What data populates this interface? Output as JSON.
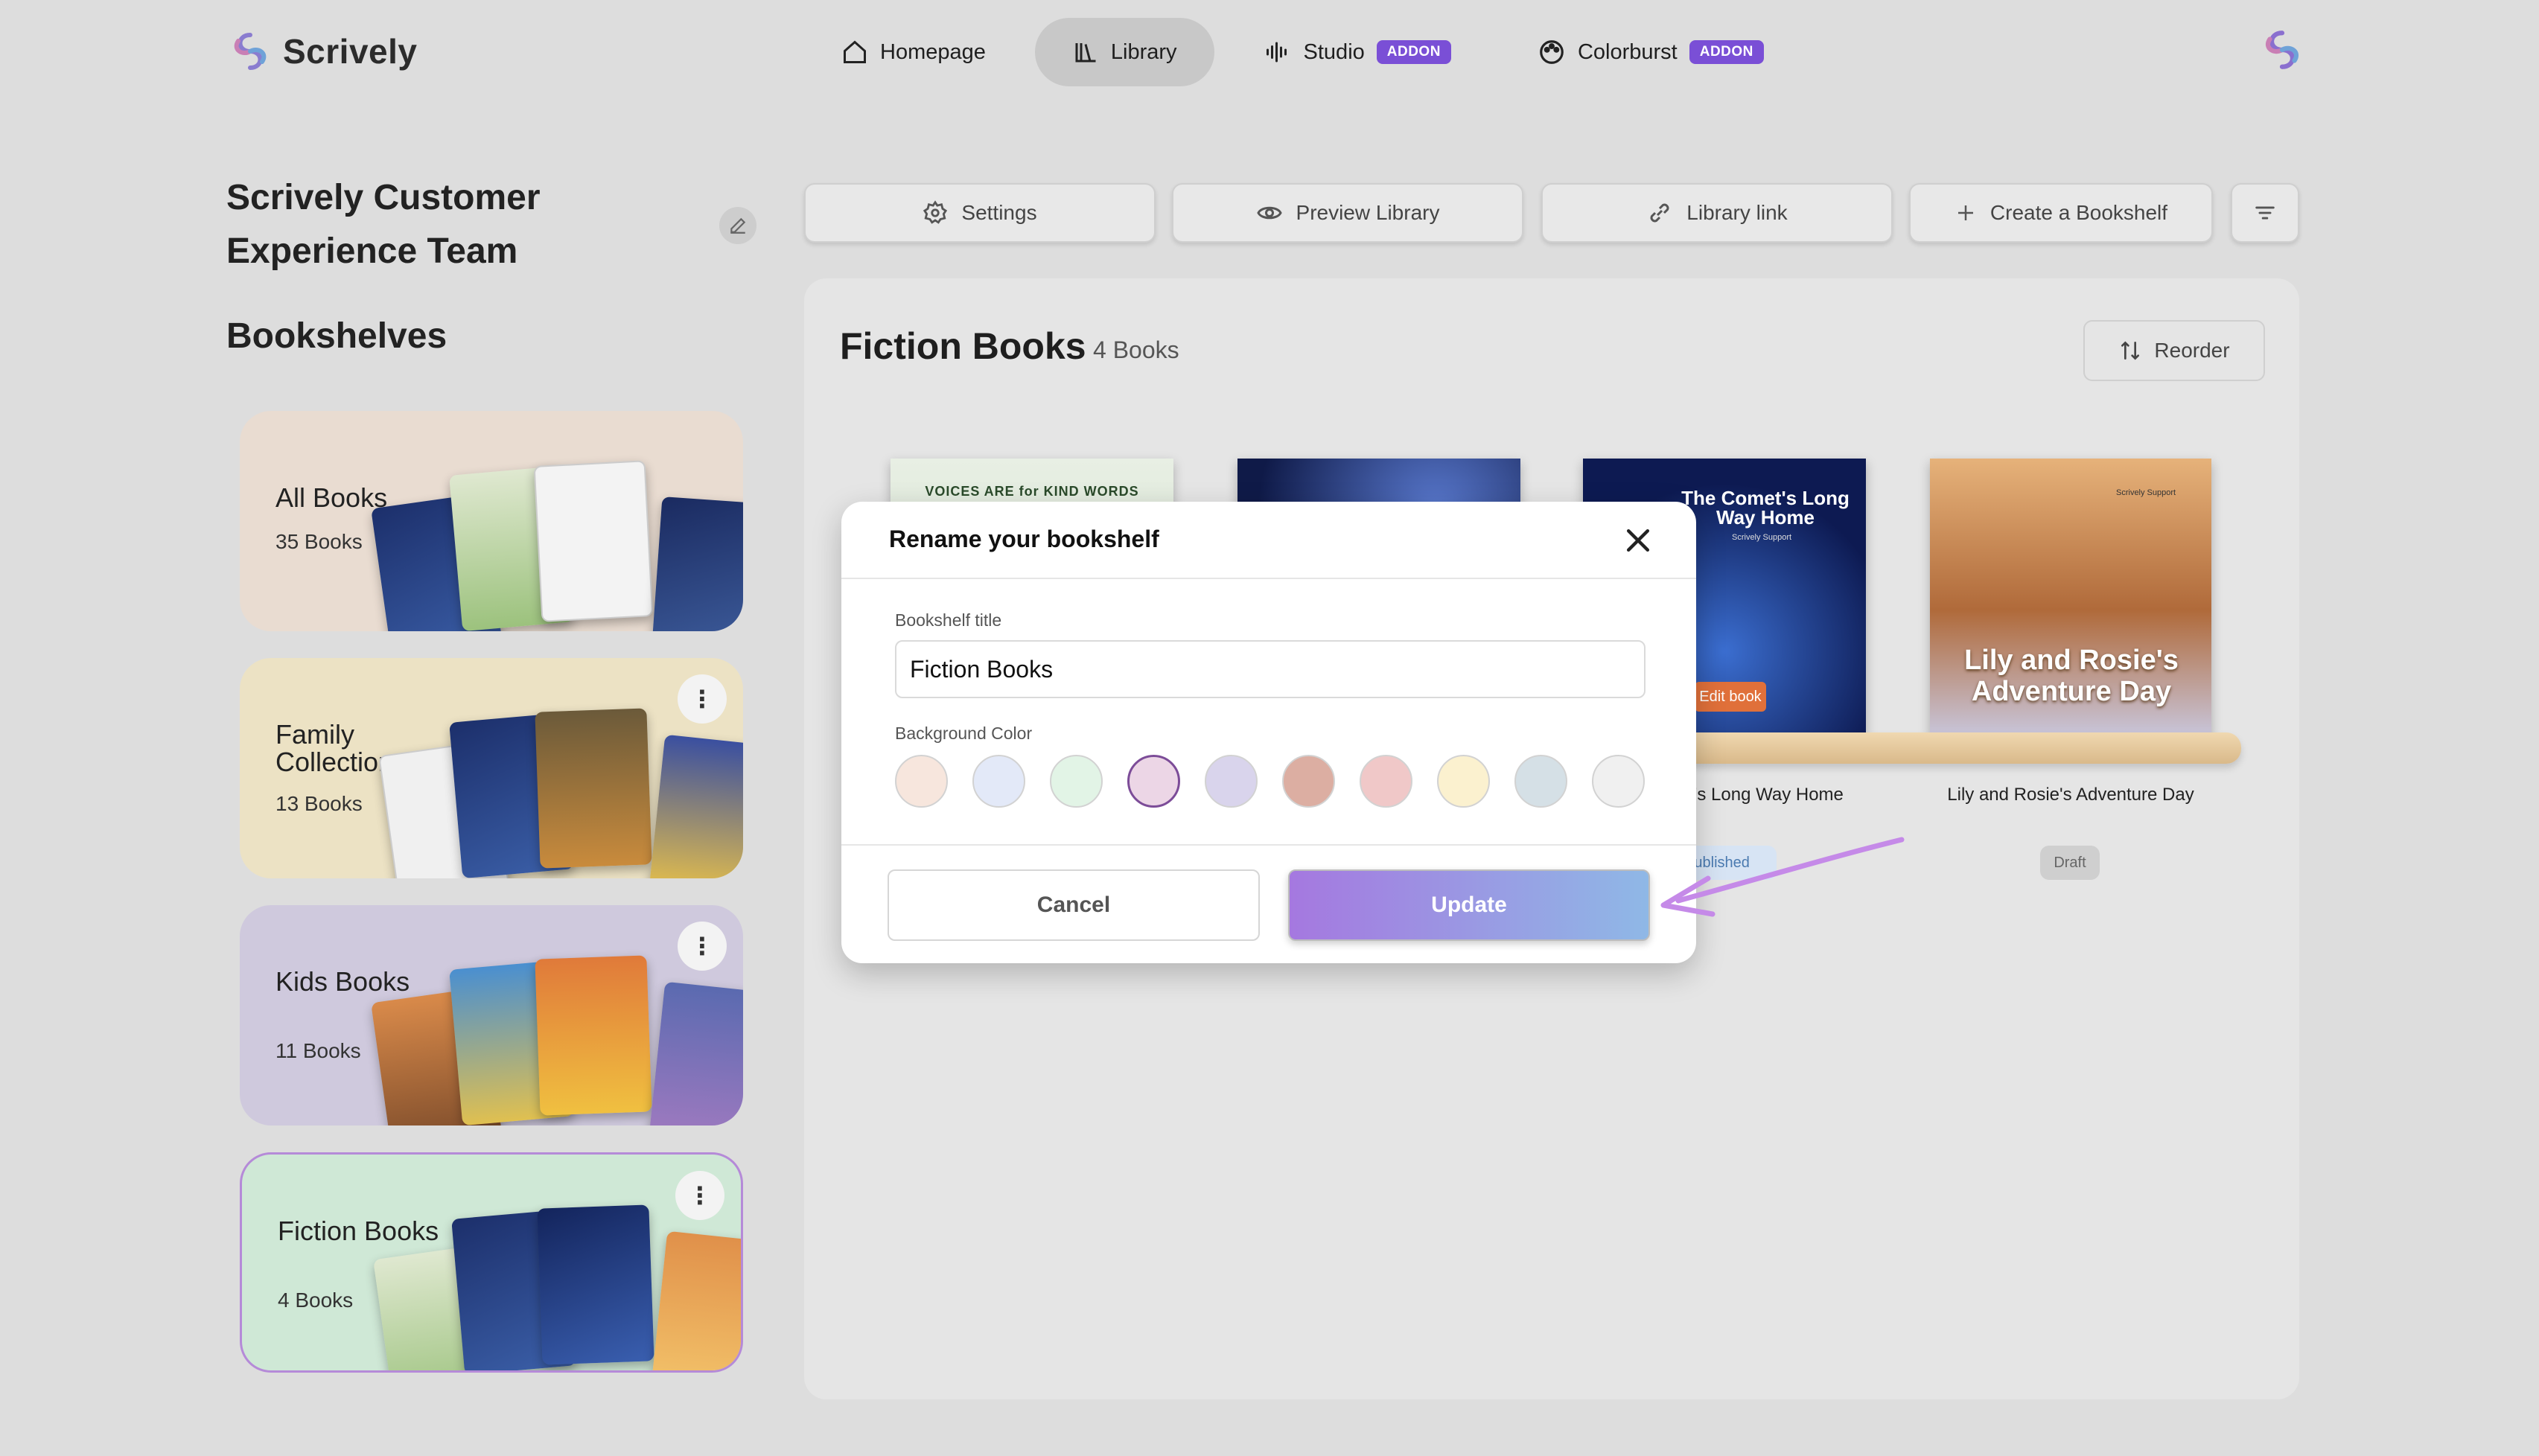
{
  "app": {
    "name": "Scrively"
  },
  "nav": {
    "items": [
      {
        "label": "Homepage",
        "icon": "home-icon",
        "active": false
      },
      {
        "label": "Library",
        "icon": "library-icon",
        "active": true
      },
      {
        "label": "Studio",
        "icon": "audio-wave-icon",
        "badge": "ADDON"
      },
      {
        "label": "Colorburst",
        "icon": "palette-icon",
        "badge": "ADDON"
      }
    ]
  },
  "sidebar": {
    "team_name": "Scrively Customer Experience Team",
    "heading": "Bookshelves",
    "shelves": [
      {
        "name": "All Books",
        "count": "35 Books",
        "color": "#e9dcd1"
      },
      {
        "name": "Family Collection",
        "count": "13 Books",
        "color": "#ece2c4"
      },
      {
        "name": "Kids Books",
        "count": "11 Books",
        "color": "#cfc9dd"
      },
      {
        "name": "Fiction Books",
        "count": "4 Books",
        "color": "#cfe8d6"
      }
    ]
  },
  "toolbar": {
    "settings": "Settings",
    "preview": "Preview Library",
    "link": "Library link",
    "create": "Create a Bookshelf"
  },
  "shelf": {
    "title": "Fiction Books",
    "count": "4 Books",
    "reorder": "Reorder",
    "books": [
      {
        "cover_text": "VOICES ARE for KIND WORDS"
      },
      {
        "cover_text": ""
      },
      {
        "cover_text": "The Comet's Long Way Home",
        "author": "Scrively Support",
        "label": "The Comet's Long Way Home",
        "status": "Published",
        "chip": "Edit book"
      },
      {
        "cover_text": "Lily and Rosie's Adventure Day",
        "author": "Scrively Support",
        "label": "Lily and Rosie's Adventure Day",
        "status": "Draft"
      }
    ]
  },
  "modal": {
    "title": "Rename your bookshelf",
    "title_label": "Bookshelf title",
    "title_value": "Fiction Books",
    "color_label": "Background Color",
    "colors": [
      "#f7e6dd",
      "#e3e9f8",
      "#e2f4e6",
      "#ecd6e6",
      "#d9d4ec",
      "#dcaea2",
      "#f0c8c8",
      "#fbf1cf",
      "#d5e0e6",
      "#f0f0f0"
    ],
    "selected_color": 3,
    "cancel": "Cancel",
    "update": "Update"
  },
  "colors": {
    "accent": "#7a4fd6",
    "arrow": "#c58ae8"
  }
}
